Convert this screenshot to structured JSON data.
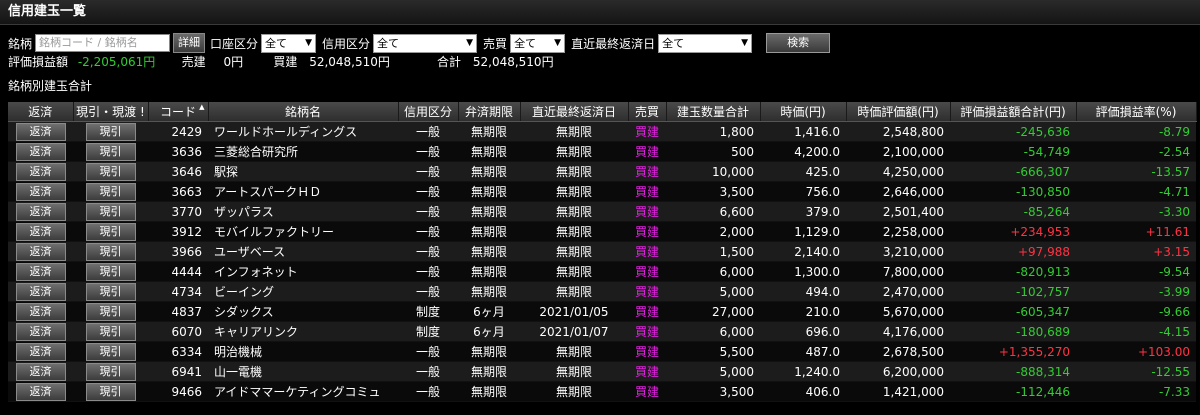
{
  "title": "信用建玉一覧",
  "filters": {
    "code_label": "銘柄",
    "code_placeholder": "銘柄コード / 銘柄名",
    "detail_button": "詳細",
    "account_label": "口座区分",
    "account_value": "全て",
    "credit_label": "信用区分",
    "credit_value": "全て",
    "trade_label": "売買",
    "trade_value": "全て",
    "due_label": "直近最終返済日",
    "due_value": "全て",
    "search_button": "検索"
  },
  "summary": {
    "pl_label": "評価損益額",
    "pl_value": "-2,205,061円",
    "sell_label": "売建",
    "sell_value": "0円",
    "buy_label": "買建",
    "buy_value": "52,048,510円",
    "total_label": "合計",
    "total_value": "52,048,510円"
  },
  "section_title": "銘柄別建玉合計",
  "columns": [
    "返済",
    "現引・現渡 !",
    "コード",
    "銘柄名",
    "信用区分",
    "弁済期限",
    "直近最終返済日",
    "売買",
    "建玉数量合計",
    "時価(円)",
    "時価評価額(円)",
    "評価損益額合計(円)",
    "評価損益率(%)"
  ],
  "colors": {
    "negative": "#33cc33",
    "positive": "#ff3344",
    "buy": "#e020e0"
  },
  "rows": [
    {
      "btn1": "返済",
      "btn2": "現引",
      "code": "2429",
      "name": "ワールドホールディングス",
      "kubun": "一般",
      "kigen": "無期限",
      "due": "無期限",
      "side": "買建",
      "qty": "1,800",
      "price": "1,416.0",
      "value": "2,548,800",
      "pl": "-245,636",
      "rate": "-8.79",
      "sign": "neg"
    },
    {
      "btn1": "返済",
      "btn2": "現引",
      "code": "3636",
      "name": "三菱総合研究所",
      "kubun": "一般",
      "kigen": "無期限",
      "due": "無期限",
      "side": "買建",
      "qty": "500",
      "price": "4,200.0",
      "value": "2,100,000",
      "pl": "-54,749",
      "rate": "-2.54",
      "sign": "neg"
    },
    {
      "btn1": "返済",
      "btn2": "現引",
      "code": "3646",
      "name": "駅探",
      "kubun": "一般",
      "kigen": "無期限",
      "due": "無期限",
      "side": "買建",
      "qty": "10,000",
      "price": "425.0",
      "value": "4,250,000",
      "pl": "-666,307",
      "rate": "-13.57",
      "sign": "neg"
    },
    {
      "btn1": "返済",
      "btn2": "現引",
      "code": "3663",
      "name": "アートスパークＨＤ",
      "kubun": "一般",
      "kigen": "無期限",
      "due": "無期限",
      "side": "買建",
      "qty": "3,500",
      "price": "756.0",
      "value": "2,646,000",
      "pl": "-130,850",
      "rate": "-4.71",
      "sign": "neg"
    },
    {
      "btn1": "返済",
      "btn2": "現引",
      "code": "3770",
      "name": "ザッパラス",
      "kubun": "一般",
      "kigen": "無期限",
      "due": "無期限",
      "side": "買建",
      "qty": "6,600",
      "price": "379.0",
      "value": "2,501,400",
      "pl": "-85,264",
      "rate": "-3.30",
      "sign": "neg"
    },
    {
      "btn1": "返済",
      "btn2": "現引",
      "code": "3912",
      "name": "モバイルファクトリー",
      "kubun": "一般",
      "kigen": "無期限",
      "due": "無期限",
      "side": "買建",
      "qty": "2,000",
      "price": "1,129.0",
      "value": "2,258,000",
      "pl": "+234,953",
      "rate": "+11.61",
      "sign": "pos"
    },
    {
      "btn1": "返済",
      "btn2": "現引",
      "code": "3966",
      "name": "ユーザベース",
      "kubun": "一般",
      "kigen": "無期限",
      "due": "無期限",
      "side": "買建",
      "qty": "1,500",
      "price": "2,140.0",
      "value": "3,210,000",
      "pl": "+97,988",
      "rate": "+3.15",
      "sign": "pos"
    },
    {
      "btn1": "返済",
      "btn2": "現引",
      "code": "4444",
      "name": "インフォネット",
      "kubun": "一般",
      "kigen": "無期限",
      "due": "無期限",
      "side": "買建",
      "qty": "6,000",
      "price": "1,300.0",
      "value": "7,800,000",
      "pl": "-820,913",
      "rate": "-9.54",
      "sign": "neg"
    },
    {
      "btn1": "返済",
      "btn2": "現引",
      "code": "4734",
      "name": "ビーイング",
      "kubun": "一般",
      "kigen": "無期限",
      "due": "無期限",
      "side": "買建",
      "qty": "5,000",
      "price": "494.0",
      "value": "2,470,000",
      "pl": "-102,757",
      "rate": "-3.99",
      "sign": "neg"
    },
    {
      "btn1": "返済",
      "btn2": "現引",
      "code": "4837",
      "name": "シダックス",
      "kubun": "制度",
      "kigen": "6ヶ月",
      "due": "2021/01/05",
      "side": "買建",
      "qty": "27,000",
      "price": "210.0",
      "value": "5,670,000",
      "pl": "-605,347",
      "rate": "-9.66",
      "sign": "neg"
    },
    {
      "btn1": "返済",
      "btn2": "現引",
      "code": "6070",
      "name": "キャリアリンク",
      "kubun": "制度",
      "kigen": "6ヶ月",
      "due": "2021/01/07",
      "side": "買建",
      "qty": "6,000",
      "price": "696.0",
      "value": "4,176,000",
      "pl": "-180,689",
      "rate": "-4.15",
      "sign": "neg"
    },
    {
      "btn1": "返済",
      "btn2": "現引",
      "code": "6334",
      "name": "明治機械",
      "kubun": "一般",
      "kigen": "無期限",
      "due": "無期限",
      "side": "買建",
      "qty": "5,500",
      "price": "487.0",
      "value": "2,678,500",
      "pl": "+1,355,270",
      "rate": "+103.00",
      "sign": "pos"
    },
    {
      "btn1": "返済",
      "btn2": "現引",
      "code": "6941",
      "name": "山一電機",
      "kubun": "一般",
      "kigen": "無期限",
      "due": "無期限",
      "side": "買建",
      "qty": "5,000",
      "price": "1,240.0",
      "value": "6,200,000",
      "pl": "-888,314",
      "rate": "-12.55",
      "sign": "neg"
    },
    {
      "btn1": "返済",
      "btn2": "現引",
      "code": "9466",
      "name": "アイドママーケティングコミュ",
      "kubun": "一般",
      "kigen": "無期限",
      "due": "無期限",
      "side": "買建",
      "qty": "3,500",
      "price": "406.0",
      "value": "1,421,000",
      "pl": "-112,446",
      "rate": "-7.33",
      "sign": "neg"
    }
  ]
}
